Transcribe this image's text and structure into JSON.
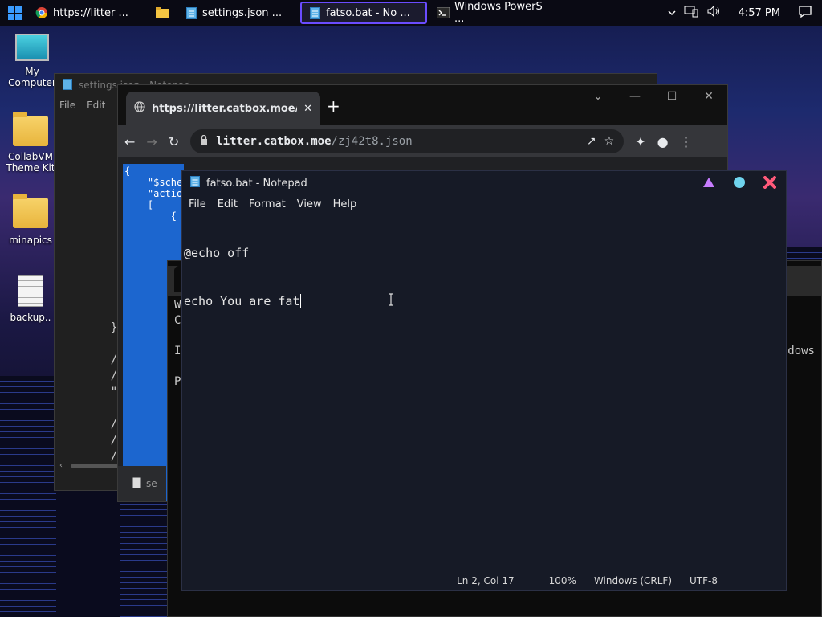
{
  "taskbar": {
    "items": [
      {
        "label": "https://litter ...",
        "icon": "chrome-icon"
      },
      {
        "label": "",
        "icon": "file-explorer-icon"
      },
      {
        "label": "settings.json  ...",
        "icon": "notepad-icon"
      },
      {
        "label": "fatso.bat - No ...",
        "icon": "notepad-icon",
        "active": true
      },
      {
        "label": "Windows PowerS ...",
        "icon": "powershell-icon"
      }
    ],
    "clock": "4:57 PM",
    "accent_color": "#6a4cff"
  },
  "desktop": {
    "icons": [
      {
        "label": "My Computer",
        "icon": "monitor-icon"
      },
      {
        "label": "CollabVM Theme Kit",
        "icon": "folder-icon"
      },
      {
        "label": "minapics",
        "icon": "folder-icon"
      },
      {
        "label": "backup..",
        "icon": "document-icon"
      }
    ]
  },
  "settings_window": {
    "title": "settings.json - Notepad",
    "menu": [
      "File",
      "Edit"
    ],
    "code_lines": [
      "        ]",
      "    },",
      "",
      "    // Ac",
      "    // To",
      "    \"sche",
      "",
      "    // Ac",
      "    // To",
      "    // To"
    ]
  },
  "chrome": {
    "tab_title": "https://litter.catbox.moe/zj42t8.json",
    "new_tab": "+",
    "url_host": "litter.catbox.moe",
    "url_path": "/zj42t8.json",
    "json_lines": [
      "{",
      "    \"$sche",
      "    \"actio",
      "    [",
      "        {"
    ],
    "download_label": "se"
  },
  "powershell": {
    "lines": [
      "Wi",
      "Co",
      "",
      "Ir",
      "",
      "PS"
    ],
    "partial_right": "ndows"
  },
  "notepad": {
    "title": "fatso.bat - Notepad",
    "menu": [
      "File",
      "Edit",
      "Format",
      "View",
      "Help"
    ],
    "line1": "@echo off",
    "line2": "echo You are fat",
    "status": {
      "position": "Ln 2, Col 17",
      "zoom": "100%",
      "eol": "Windows (CRLF)",
      "encoding": "UTF-8"
    },
    "ctrl_colors": {
      "minimize": "#c77dff",
      "maximize": "#6fd4ee",
      "close": "#ff5a7a"
    }
  }
}
